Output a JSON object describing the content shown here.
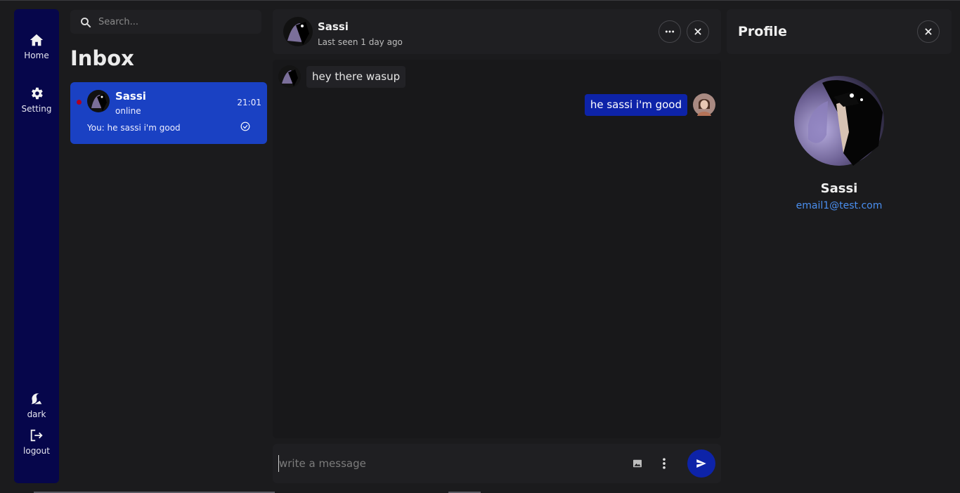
{
  "nav": {
    "home_label": "Home",
    "setting_label": "Setting",
    "theme_label": "dark",
    "logout_label": "logout"
  },
  "search": {
    "placeholder": "Search..."
  },
  "inbox": {
    "title": "Inbox",
    "conversations": [
      {
        "name": "Sassi",
        "status": "online",
        "time": "21:01",
        "last_message": "You: he sassi i'm good",
        "unread_indicator_color": "#b00020"
      }
    ]
  },
  "chat": {
    "contact_name": "Sassi",
    "last_seen": "Last seen 1 day ago",
    "messages": [
      {
        "direction": "incoming",
        "text": "hey there wasup"
      },
      {
        "direction": "outgoing",
        "text": "he sassi i'm good"
      }
    ],
    "composer_placeholder": "write a message"
  },
  "profile": {
    "title": "Profile",
    "name": "Sassi",
    "email": "email1@test.com"
  },
  "colors": {
    "rail_bg": "#06064b",
    "active_conversation": "#1a41c3",
    "outgoing_bubble": "#0d23a8",
    "send_button": "#0d23a8",
    "email_link": "#4a8ff0",
    "background": "#1b1b1d"
  }
}
